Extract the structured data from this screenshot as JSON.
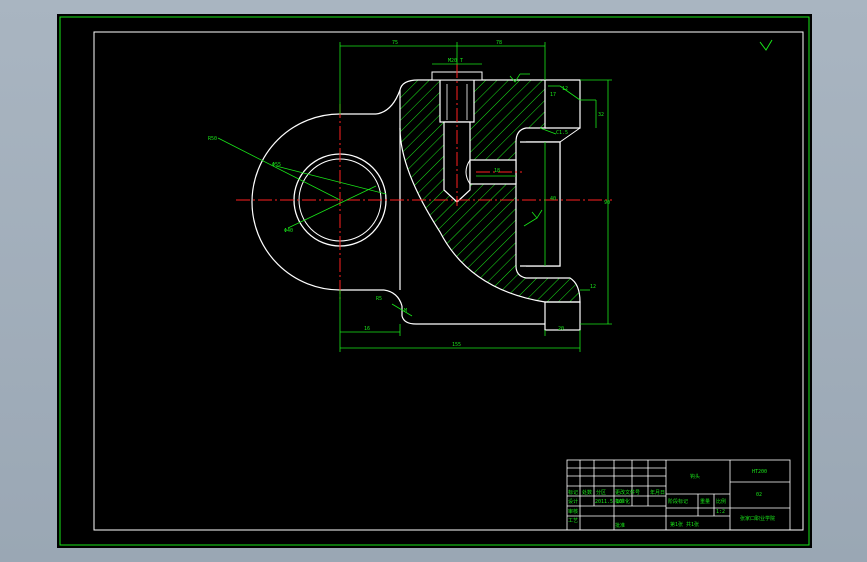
{
  "drawing": {
    "roughness_symbol": "∇",
    "dimensions": {
      "d_75": "75",
      "d_78": "78",
      "d_thread": "M20 T",
      "d_12": "12",
      "d_17": "17",
      "d_32": "32",
      "d_r10": "R10",
      "d_c1": "C1.5",
      "d_18": "18",
      "d_40": "40",
      "d_r50": "R50",
      "d_phi_out": "Φ55",
      "d_phi_in": "Φ40",
      "d_r5": "R5",
      "d_m": "M",
      "d_16": "16",
      "d_155": "155",
      "d_20": "20",
      "d_12b": "12",
      "d_height": "90"
    }
  },
  "title_block": {
    "part_name": "钩头",
    "material": "HT200",
    "scale": "1:2",
    "sheet": "第1张 共1张",
    "designer": "设计",
    "checker": "审核",
    "process": "工艺",
    "approve": "批准",
    "stage_mark": "阶段标记",
    "weight": "重量",
    "ratio": "比例",
    "standard": "标准化",
    "date": "2011.5.16",
    "sign": "签名",
    "marks": "标记",
    "count": "处数",
    "zone": "分区",
    "doc_no": "更改文件号",
    "ymd": "年月日",
    "code": "02",
    "company": "张家口职业学院"
  }
}
